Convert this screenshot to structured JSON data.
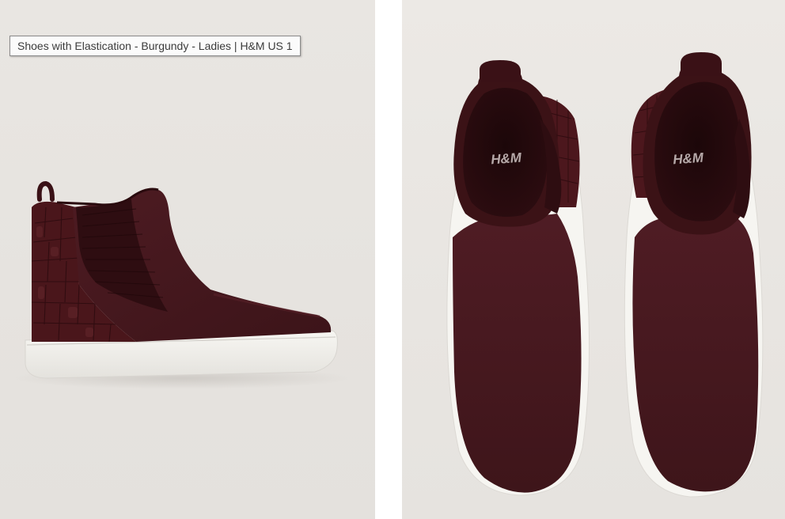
{
  "tooltip": {
    "text": "Shoes with Elastication - Burgundy - Ladies | H&M US 1"
  },
  "insole_brand": {
    "left": "H&M",
    "right": "H&M"
  },
  "colors": {
    "suede": "#4a1a20",
    "sole": "#f4f3ef",
    "background": "#e8e5e1"
  }
}
